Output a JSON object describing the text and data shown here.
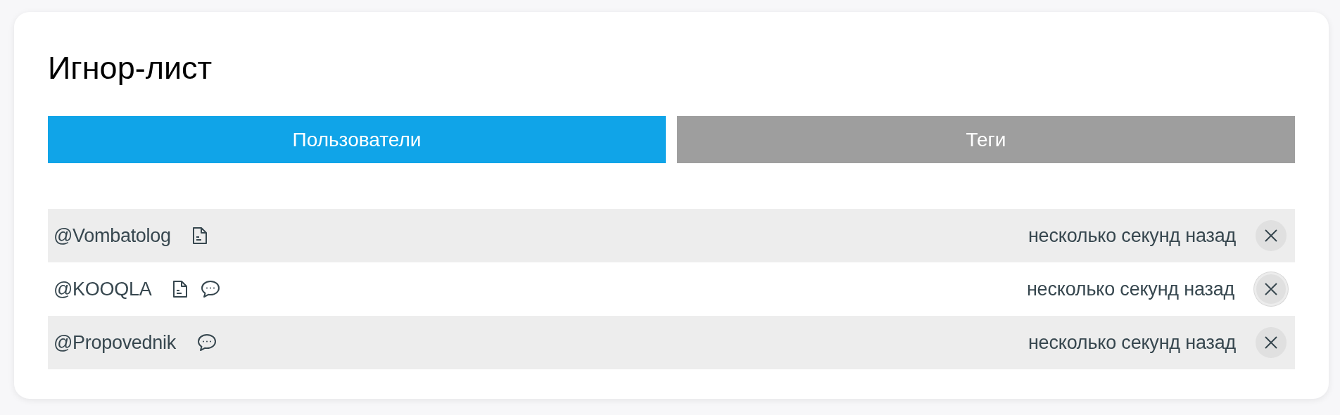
{
  "title": "Игнор-лист",
  "tabs": [
    {
      "label": "Пользователи",
      "selected": true
    },
    {
      "label": "Теги",
      "selected": false
    }
  ],
  "users": [
    {
      "name": "@Vombatolog",
      "posts": true,
      "comments": false,
      "time": "несколько секунд назад",
      "focused": false
    },
    {
      "name": "@KOOQLA",
      "posts": true,
      "comments": true,
      "time": "несколько секунд назад",
      "focused": true
    },
    {
      "name": "@Propovednik",
      "posts": false,
      "comments": true,
      "time": "несколько секунд назад",
      "focused": false
    }
  ]
}
